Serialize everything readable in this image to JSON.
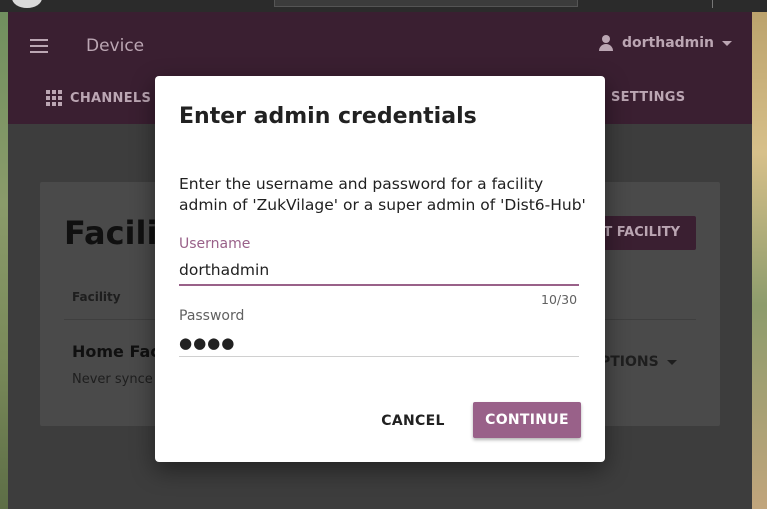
{
  "appbar": {
    "title": "Device",
    "user_name": "dorthadmin",
    "tabs": {
      "channels": "CHANNELS",
      "settings": "SETTINGS"
    }
  },
  "card": {
    "title": "Facilit",
    "import_button": "T FACILITY",
    "column_header": "Facility",
    "facility_name": "Home Fac",
    "facility_status": "Never synce",
    "options_label": "PTIONS"
  },
  "dialog": {
    "title": "Enter admin credentials",
    "description": "Enter the username and password for a facility admin of 'ZukVilage' or a super admin of 'Dist6-Hub'",
    "username_label": "Username",
    "username_value": "dorthadmin",
    "username_counter": "10/30",
    "password_label": "Password",
    "password_value": "●●●●",
    "cancel_label": "CANCEL",
    "continue_label": "CONTINUE"
  },
  "colors": {
    "brand": "#996189",
    "appbar_dim": "#3a1f31",
    "overlay": "#3d3d3d"
  },
  "icons": [
    "hamburger-icon",
    "user-icon",
    "chevron-down-icon",
    "grid-icon"
  ]
}
